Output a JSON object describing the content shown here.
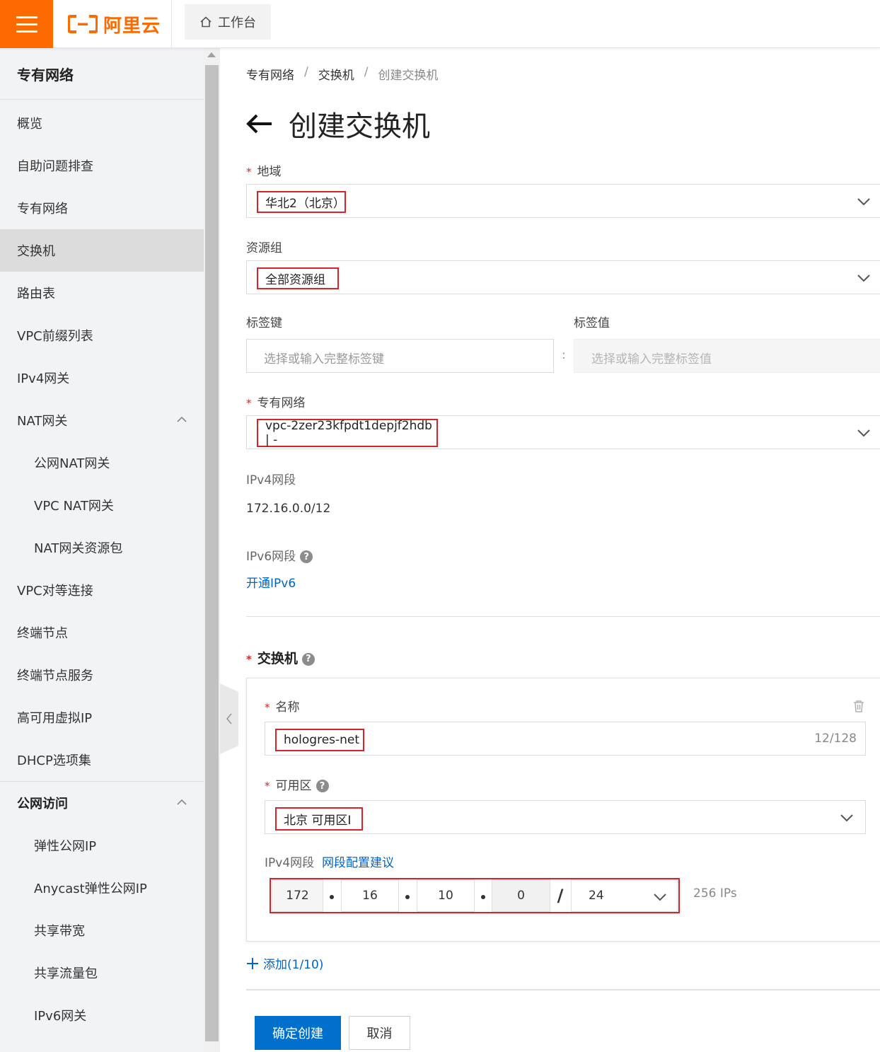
{
  "topbar": {
    "brand": "阿里云",
    "workbench_label": "工作台"
  },
  "sidebar": {
    "title": "专有网络",
    "items": [
      {
        "label": "概览"
      },
      {
        "label": "自助问题排查"
      },
      {
        "label": "专有网络"
      },
      {
        "label": "交换机",
        "active": true
      },
      {
        "label": "路由表"
      },
      {
        "label": "VPC前缀列表"
      },
      {
        "label": "IPv4网关"
      },
      {
        "label": "NAT网关",
        "expanded": true
      },
      {
        "label": "公网NAT网关",
        "sub": true
      },
      {
        "label": "VPC NAT网关",
        "sub": true
      },
      {
        "label": "NAT网关资源包",
        "sub": true
      },
      {
        "label": "VPC对等连接"
      },
      {
        "label": "终端节点"
      },
      {
        "label": "终端节点服务"
      },
      {
        "label": "高可用虚拟IP"
      },
      {
        "label": "DHCP选项集"
      }
    ],
    "group": {
      "label": "公网访问",
      "expanded": true
    },
    "group_items": [
      {
        "label": "弹性公网IP"
      },
      {
        "label": "Anycast弹性公网IP"
      },
      {
        "label": "共享带宽"
      },
      {
        "label": "共享流量包"
      },
      {
        "label": "IPv6网关"
      }
    ]
  },
  "breadcrumb": {
    "items": [
      "专有网络",
      "交换机",
      "创建交换机"
    ],
    "separator": "/"
  },
  "page": {
    "title": "创建交换机"
  },
  "form": {
    "region": {
      "label": "地域",
      "value": "华北2（北京）"
    },
    "resource_group": {
      "label": "资源组",
      "value": "全部资源组"
    },
    "tag_key": {
      "label": "标签键",
      "placeholder": "选择或输入完整标签键"
    },
    "tag_value": {
      "label": "标签值",
      "placeholder": "选择或输入完整标签值"
    },
    "tag_colon": ":",
    "vpc": {
      "label": "专有网络",
      "value": "vpc-2zer23kfpdt1depjf2hdb | -"
    },
    "vpc_ipv4": {
      "label": "IPv4网段",
      "value": "172.16.0.0/12"
    },
    "vpc_ipv6": {
      "label": "IPv6网段",
      "link": "开通IPv6"
    },
    "vswitch_section": {
      "label": "交换机"
    },
    "vswitch": {
      "name_label": "名称",
      "name_value": "hologres-net",
      "name_counter": "12/128",
      "zone_label": "可用区",
      "zone_value": "北京 可用区I",
      "ipv4_label": "IPv4网段",
      "ipv4_suggest_link": "网段配置建议",
      "ip_octets": [
        "172",
        "16",
        "10",
        "0"
      ],
      "ip_slash": "/",
      "ip_mask": "24",
      "ip_count": "256 IPs"
    },
    "add_link": "添加(1/10)",
    "confirm_button": "确定创建",
    "cancel_button": "取消"
  },
  "colors": {
    "brand": "#ff6a00",
    "primary": "#0070cc",
    "highlight": "#d6242b",
    "link": "#0064c8"
  }
}
